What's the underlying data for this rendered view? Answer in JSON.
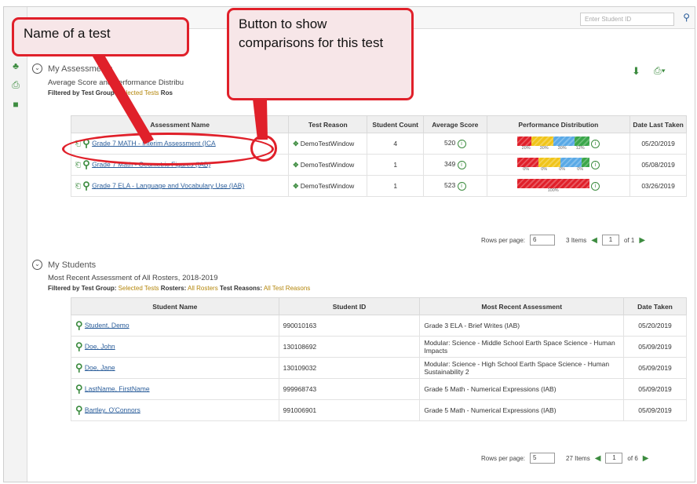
{
  "topbar": {
    "search_placeholder": "Enter Student ID"
  },
  "assessments": {
    "title": "My Assessments",
    "subtitle": "Average Score and Performance Distribu",
    "filter_label": "Filtered by",
    "filter_test_group_label": "Test Group:",
    "filter_test_group_value": "Selected Tests",
    "filter_rosters_label": "Ros",
    "columns": [
      "Assessment Name",
      "Test Reason",
      "Student Count",
      "Average Score",
      "Performance Distribution",
      "Date Last Taken"
    ],
    "rows": [
      {
        "name": "Grade 7 MATH - Interim Assessment (ICA",
        "reason": "DemoTestWindow",
        "count": "4",
        "score": "520",
        "dist": [
          20,
          30,
          30,
          20
        ],
        "labels": [
          "20%",
          "30%",
          "30%",
          "12%"
        ],
        "date": "05/20/2019"
      },
      {
        "name": "Grade 7 Math - Geometric Figures (IAB)",
        "reason": "DemoTestWindow",
        "count": "1",
        "score": "349",
        "dist": [
          30,
          30,
          30,
          10
        ],
        "labels": [
          "0%",
          "0%",
          "0%",
          "0%"
        ],
        "date": "05/08/2019"
      },
      {
        "name": "Grade 7 ELA - Language and Vocabulary Use (IAB)",
        "reason": "DemoTestWindow",
        "count": "1",
        "score": "523",
        "dist": [
          100,
          0,
          0,
          0
        ],
        "labels": [
          "100%"
        ],
        "date": "03/26/2019"
      }
    ],
    "rows_per_page_label": "Rows per page:",
    "rows_per_page": "6",
    "items": "3 Items",
    "page": "1",
    "of": "of 1"
  },
  "students": {
    "title": "My Students",
    "subtitle": "Most Recent Assessment of All Rosters, 2018-2019",
    "filter_label": "Filtered by",
    "filter_test_group_label": "Test Group:",
    "filter_test_group_value": "Selected Tests",
    "filter_rosters_label": "Rosters:",
    "filter_rosters_value": "All Rosters",
    "filter_reasons_label": "Test Reasons:",
    "filter_reasons_value": "All Test Reasons",
    "columns": [
      "Student Name",
      "Student ID",
      "Most Recent Assessment",
      "Date Taken"
    ],
    "rows": [
      {
        "name": "Student, Demo",
        "id": "990010163",
        "assessment": "Grade 3 ELA - Brief Writes (IAB)",
        "date": "05/20/2019"
      },
      {
        "name": "Doe, John",
        "id": "130108692",
        "assessment": "Modular: Science - Middle School Earth Space Science - Human Impacts",
        "date": "05/09/2019"
      },
      {
        "name": "Doe, Jane",
        "id": "130109032",
        "assessment": "Modular: Science - High School Earth Space Science - Human Sustainability 2",
        "date": "05/09/2019"
      },
      {
        "name": "LastName, FirstName",
        "id": "999968743",
        "assessment": "Grade 5 Math - Numerical Expressions (IAB)",
        "date": "05/09/2019"
      },
      {
        "name": "Bartley, O'Connors",
        "id": "991006901",
        "assessment": "Grade 5 Math - Numerical Expressions (IAB)",
        "date": "05/09/2019"
      }
    ],
    "rows_per_page_label": "Rows per page:",
    "rows_per_page": "5",
    "items": "27 Items",
    "page": "1",
    "of": "of 6"
  },
  "callouts": {
    "name_of_test": "Name of a test",
    "comparisons": "Button to show comparisons for this test"
  },
  "colors": {
    "red": "#e0202a",
    "orange": "#f3a21c",
    "yellow": "#f0c419",
    "blue": "#59a9e6",
    "green": "#3aa64a",
    "accent": "#3d8c40"
  }
}
